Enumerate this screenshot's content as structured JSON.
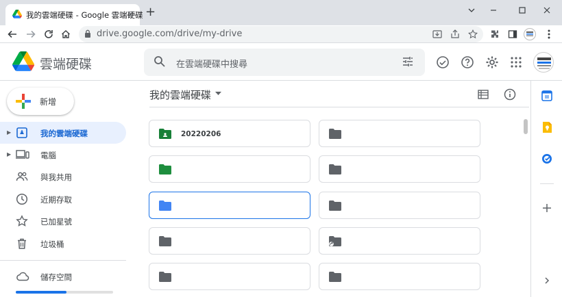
{
  "browser": {
    "tab_title": "我的雲端硬碟 - Google 雲端硬碟",
    "tab_close": "×",
    "new_tab": "+",
    "url": "drive.google.com/drive/my-drive"
  },
  "app": {
    "name": "雲端硬碟",
    "search_placeholder": "在雲端硬碟中搜尋",
    "new_button": "新增"
  },
  "sidebar": {
    "items": [
      {
        "label": "我的雲端硬碟",
        "icon": "my-drive-icon",
        "active": true,
        "expandable": true
      },
      {
        "label": "電腦",
        "icon": "computers-icon",
        "active": false,
        "expandable": true
      },
      {
        "label": "與我共用",
        "icon": "shared-icon",
        "active": false,
        "expandable": false
      },
      {
        "label": "近期存取",
        "icon": "clock-icon",
        "active": false,
        "expandable": false
      },
      {
        "label": "已加星號",
        "icon": "star-icon",
        "active": false,
        "expandable": false
      },
      {
        "label": "垃圾桶",
        "icon": "trash-icon",
        "active": false,
        "expandable": false
      },
      {
        "label": "儲存空間",
        "icon": "cloud-icon",
        "active": false,
        "expandable": false
      }
    ],
    "storage_fraction": 0.52
  },
  "main": {
    "breadcrumb": "我的雲端硬碟",
    "folders": [
      {
        "name": "20220206",
        "icon": "shared-folder-icon",
        "color": "#188038",
        "selected": false
      },
      {
        "name": "",
        "icon": "folder-icon",
        "color": "#5f6368",
        "selected": false
      },
      {
        "name": "",
        "icon": "folder-icon",
        "color": "#1e8e3e",
        "selected": false
      },
      {
        "name": "",
        "icon": "folder-icon",
        "color": "#5f6368",
        "selected": false
      },
      {
        "name": "",
        "icon": "folder-icon",
        "color": "#4285f4",
        "selected": true
      },
      {
        "name": "",
        "icon": "folder-icon",
        "color": "#5f6368",
        "selected": false
      },
      {
        "name": "",
        "icon": "folder-icon",
        "color": "#5f6368",
        "selected": false
      },
      {
        "name": "",
        "icon": "shortcut-folder-icon",
        "color": "#5f6368",
        "selected": false
      },
      {
        "name": "",
        "icon": "folder-icon",
        "color": "#5f6368",
        "selected": false
      },
      {
        "name": "",
        "icon": "folder-icon",
        "color": "#5f6368",
        "selected": false
      }
    ]
  },
  "colors": {
    "accent": "#1a73e8",
    "active_bg": "#e8f0fe",
    "selected_folder": "#4285f4",
    "green_folder": "#1e8e3e"
  }
}
